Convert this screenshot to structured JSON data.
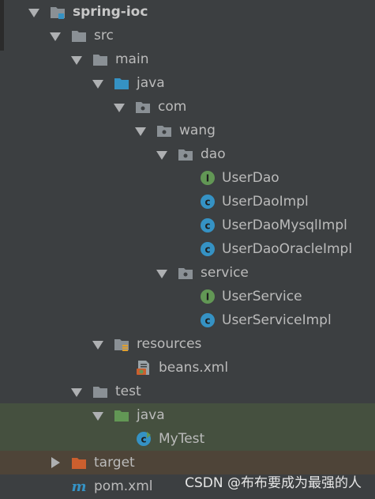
{
  "tree": {
    "project": "spring-ioc",
    "src": "src",
    "main": "main",
    "main_java": "java",
    "com": "com",
    "wang": "wang",
    "dao": "dao",
    "dao_items": [
      "UserDao",
      "UserDaoImpl",
      "UserDaoMysqlImpl",
      "UserDaoOracleImpl"
    ],
    "service": "service",
    "service_items": [
      "UserService",
      "UserServiceImpl"
    ],
    "resources": "resources",
    "beans": "beans.xml",
    "test": "test",
    "test_java": "java",
    "mytest": "MyTest",
    "target": "target",
    "pom": "pom.xml"
  },
  "colors": {
    "interface_badge": "#629755",
    "class_badge": "#3592c4",
    "folder": "#8a9095",
    "source_folder": "#3592c4",
    "test_folder": "#629755",
    "excluded_folder": "#cb5f2e"
  },
  "icons": {
    "expanded": "triangle-down",
    "collapsed": "triangle-right"
  },
  "watermark": "CSDN @布布要成为最强的人"
}
